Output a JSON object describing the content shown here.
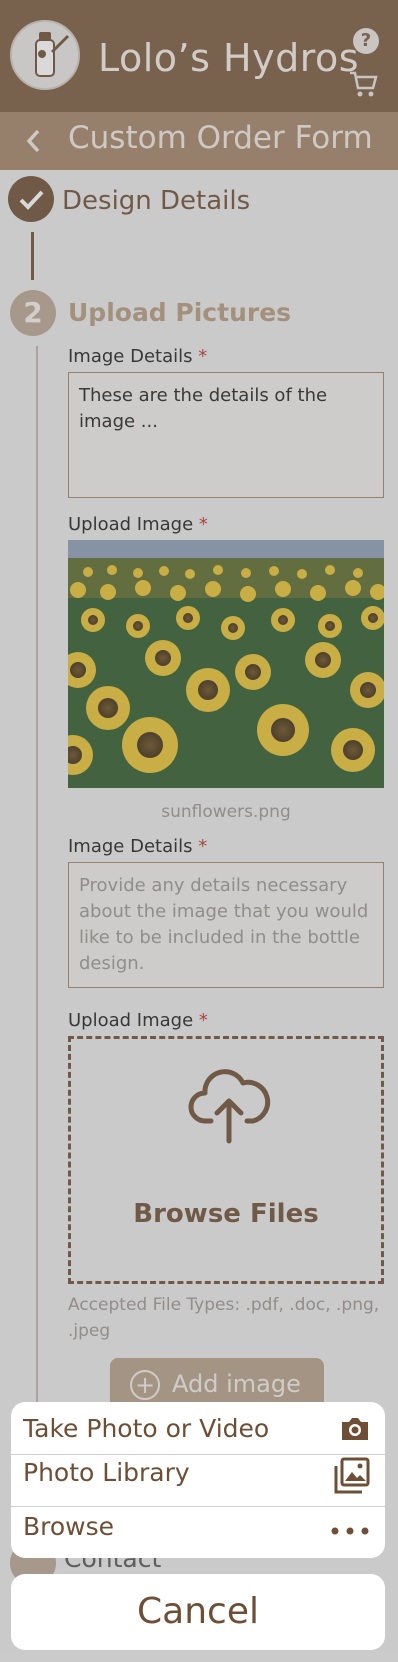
{
  "header": {
    "app_title": "Lolo’s Hydros",
    "help_label": "?",
    "page_title": "Custom Order Form"
  },
  "steps": {
    "step1": {
      "label": "Design Details",
      "state": "completed"
    },
    "step2": {
      "number": "2",
      "label": "Upload Pictures",
      "state": "active"
    },
    "step4": {
      "label": "Contact"
    }
  },
  "form": {
    "image_details_label": "Image Details",
    "upload_image_label": "Upload Image",
    "required_mark": "*",
    "first_details_value": "These are the details of the image ...",
    "uploaded_filename": "sunflowers.png",
    "second_details_placeholder": "Provide any details necessary about the image that you would like to be included in the bottle design.",
    "browse_files": "Browse Files",
    "accepted_types": "Accepted File Types: .pdf, .doc, .png, .jpeg",
    "add_image": "Add image"
  },
  "action_sheet": {
    "items": [
      {
        "label": "Take Photo or Video",
        "icon": "camera-icon"
      },
      {
        "label": "Photo Library",
        "icon": "photo-library-icon"
      },
      {
        "label": "Browse",
        "icon": "more-dots-icon"
      }
    ],
    "cancel": "Cancel"
  },
  "colors": {
    "brand_brown": "#7a5a3e",
    "dark_brown": "#6e4f35",
    "required_red": "#c03030"
  }
}
